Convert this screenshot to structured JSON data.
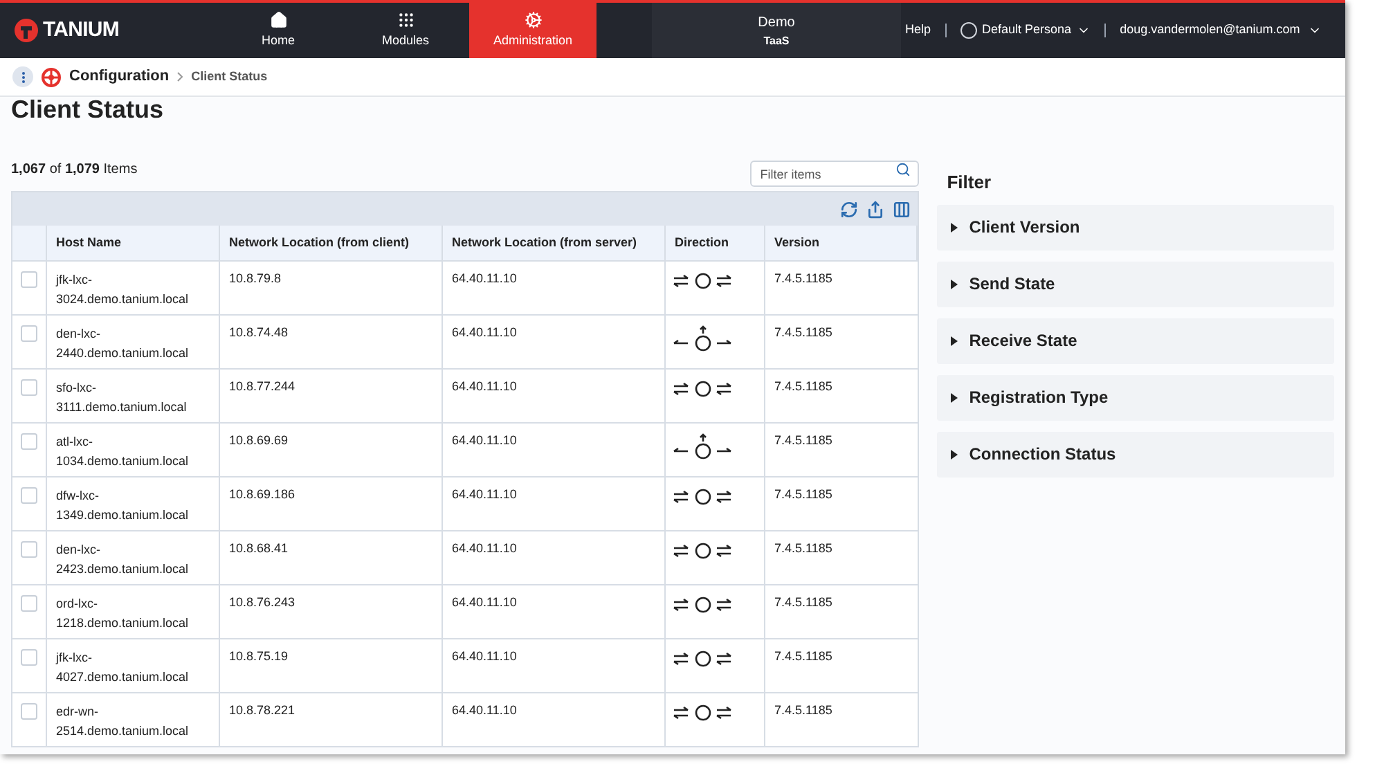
{
  "brand": {
    "name": "TANIUM"
  },
  "nav": [
    {
      "label": "Home",
      "selected": false
    },
    {
      "label": "Modules",
      "selected": false
    },
    {
      "label": "Administration",
      "selected": true
    }
  ],
  "environment": {
    "name": "Demo",
    "sub": "TaaS"
  },
  "header_links": {
    "help": "Help",
    "persona": "Default Persona",
    "user": "doug.vandermolen@tanium.com"
  },
  "breadcrumb": {
    "module": "Configuration",
    "page": "Client Status"
  },
  "page_title": "Client Status",
  "count": {
    "shown": "1,067",
    "of": "of",
    "total": "1,079",
    "unit": "Items"
  },
  "filter_field": {
    "placeholder": "Filter items"
  },
  "table": {
    "columns": [
      "Host Name",
      "Network Location (from client)",
      "Network Location (from server)",
      "Direction",
      "Version"
    ],
    "rows": [
      {
        "checked": false,
        "host": "jfk-lxc-3024.demo.tanium.local",
        "client": "10.8.79.8",
        "server": "64.40.11.10",
        "kind": "both",
        "version": "7.4.5.1185"
      },
      {
        "checked": false,
        "host": "den-lxc-2440.demo.tanium.local",
        "client": "10.8.74.48",
        "server": "64.40.11.10",
        "kind": "out",
        "version": "7.4.5.1185"
      },
      {
        "checked": false,
        "host": "sfo-lxc-3111.demo.tanium.local",
        "client": "10.8.77.244",
        "server": "64.40.11.10",
        "kind": "both",
        "version": "7.4.5.1185"
      },
      {
        "checked": false,
        "host": "atl-lxc-1034.demo.tanium.local",
        "client": "10.8.69.69",
        "server": "64.40.11.10",
        "kind": "out",
        "version": "7.4.5.1185"
      },
      {
        "checked": false,
        "host": "dfw-lxc-1349.demo.tanium.local",
        "client": "10.8.69.186",
        "server": "64.40.11.10",
        "kind": "both",
        "version": "7.4.5.1185"
      },
      {
        "checked": false,
        "host": "den-lxc-2423.demo.tanium.local",
        "client": "10.8.68.41",
        "server": "64.40.11.10",
        "kind": "both",
        "version": "7.4.5.1185"
      },
      {
        "checked": false,
        "host": "ord-lxc-1218.demo.tanium.local",
        "client": "10.8.76.243",
        "server": "64.40.11.10",
        "kind": "both",
        "version": "7.4.5.1185"
      },
      {
        "checked": false,
        "host": "jfk-lxc-4027.demo.tanium.local",
        "client": "10.8.75.19",
        "server": "64.40.11.10",
        "kind": "both",
        "version": "7.4.5.1185"
      },
      {
        "checked": false,
        "host": "edr-wn-2514.demo.tanium.local",
        "client": "10.8.78.221",
        "server": "64.40.11.10",
        "kind": "both",
        "version": "7.4.5.1185"
      }
    ]
  },
  "filter": {
    "title": "Filter",
    "sections": [
      {
        "label": "Client Version",
        "expanded": false
      },
      {
        "label": "Send State",
        "expanded": false
      },
      {
        "label": "Receive State",
        "expanded": false
      },
      {
        "label": "Registration Type",
        "expanded": false
      },
      {
        "label": "Connection Status",
        "expanded": false
      }
    ]
  }
}
